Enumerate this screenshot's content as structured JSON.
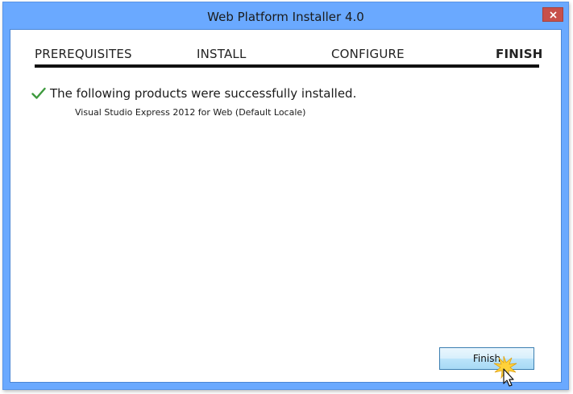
{
  "window": {
    "title": "Web Platform Installer 4.0"
  },
  "steps": [
    {
      "label": "PREREQUISITES",
      "active": false
    },
    {
      "label": "INSTALL",
      "active": false
    },
    {
      "label": "CONFIGURE",
      "active": false
    },
    {
      "label": "FINISH",
      "active": true
    }
  ],
  "result": {
    "message": "The following products were successfully installed.",
    "products": [
      "Visual Studio Express 2012 for Web (Default Locale)"
    ]
  },
  "buttons": {
    "finish_label": "Finish"
  },
  "icons": {
    "close": "close-icon",
    "success": "checkmark-icon",
    "cursor": "mouse-cursor-icon",
    "click_highlight": "click-burst-icon"
  },
  "colors": {
    "frame": "#6aa9ff",
    "close": "#c7504a",
    "check": "#3e9a3e",
    "step_bar": "#111111",
    "button_border": "#3c7fb1"
  }
}
